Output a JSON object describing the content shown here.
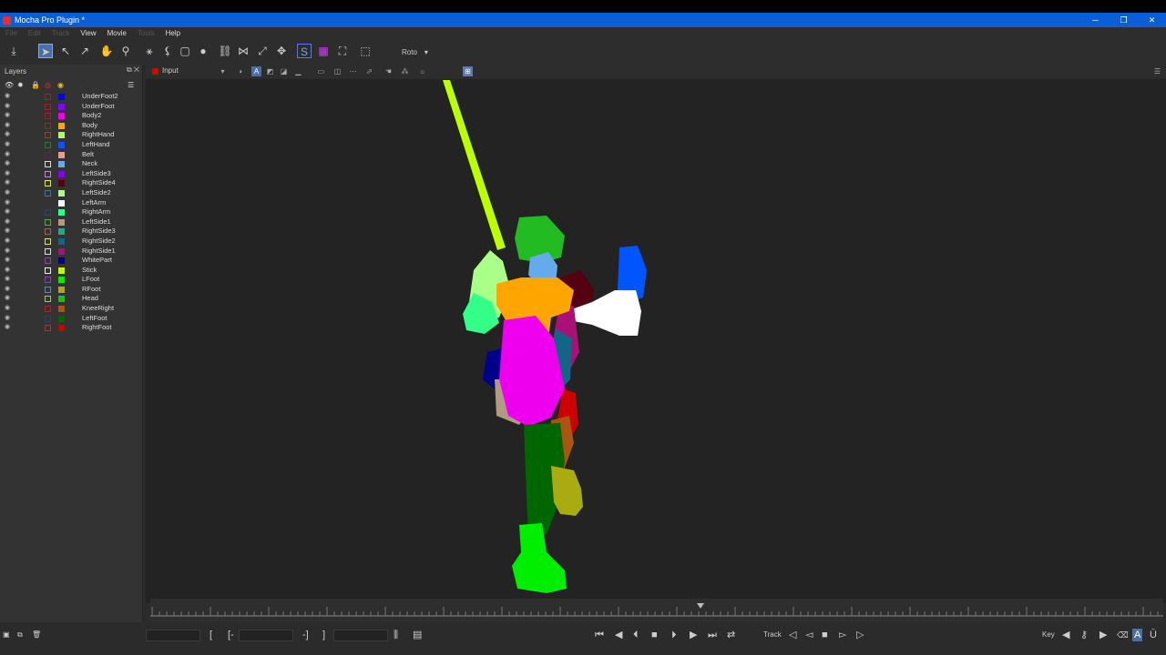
{
  "window": {
    "title": "Mocha Pro Plugin *",
    "controls": [
      "─",
      "❐",
      "✕"
    ]
  },
  "menu": [
    {
      "label": "File",
      "enabled": false
    },
    {
      "label": "Edit",
      "enabled": false
    },
    {
      "label": "Track",
      "enabled": false
    },
    {
      "label": "View",
      "enabled": true
    },
    {
      "label": "Movie",
      "enabled": true
    },
    {
      "label": "Tools",
      "enabled": false
    },
    {
      "label": "Help",
      "enabled": true
    }
  ],
  "toolbar": {
    "mode_label": "Roto",
    "mode_arrow": "▾"
  },
  "layers_panel": {
    "title": "Layers",
    "layers": [
      {
        "name": "UnderFoot2",
        "outline": "#a02020",
        "color": "#0000ff"
      },
      {
        "name": "UnderFoot",
        "outline": "#a02020",
        "color": "#8800ff"
      },
      {
        "name": "Body2",
        "outline": "#a02020",
        "color": "#ee00ee"
      },
      {
        "name": "Body",
        "outline": "#a02020",
        "color": "#ffa500"
      },
      {
        "name": "RightHand",
        "outline": "#a04020",
        "color": "#aaff66"
      },
      {
        "name": "LeftHand",
        "outline": "#208020",
        "color": "#0055ff"
      },
      {
        "name": "Belt",
        "outline": "#602060",
        "color": "#ee9a88"
      },
      {
        "name": "Neck",
        "outline": "#dddddd",
        "color": "#66aaee"
      },
      {
        "name": "LeftSide3",
        "outline": "#cc88cc",
        "color": "#8800ee"
      },
      {
        "name": "RightSide4",
        "outline": "#eeee22",
        "color": "#550011"
      },
      {
        "name": "LeftSide2",
        "outline": "#3377bb",
        "color": "#aaff88"
      },
      {
        "name": "LeftArm",
        "outline": "#333333",
        "color": "#ffffff"
      },
      {
        "name": "RightArm",
        "outline": "#224488",
        "color": "#33ff88"
      },
      {
        "name": "LeftSide1",
        "outline": "#22cc22",
        "color": "#b09a80"
      },
      {
        "name": "RightSide3",
        "outline": "#aa6622",
        "color": "#22aa88"
      },
      {
        "name": "RightSide2",
        "outline": "#dddd88",
        "color": "#116688"
      },
      {
        "name": "RightSide1",
        "outline": "#dddddd",
        "color": "#aa1177"
      },
      {
        "name": "WhitePart",
        "outline": "#8844aa",
        "color": "#000088"
      },
      {
        "name": "Stick",
        "outline": "#eeeeee",
        "color": "#bbff00"
      },
      {
        "name": "LFoot",
        "outline": "#8844aa",
        "color": "#00ee00"
      },
      {
        "name": "RFoot",
        "outline": "#22aaaa",
        "color": "#aaaa11"
      },
      {
        "name": "Head",
        "outline": "#88dd22",
        "color": "#22bb22"
      },
      {
        "name": "KneeRight",
        "outline": "#aa2222",
        "color": "#aa5511"
      },
      {
        "name": "LeftFoot",
        "outline": "#333399",
        "color": "#006600"
      },
      {
        "name": "RightFoot",
        "outline": "#cc2222",
        "color": "#cc0000"
      }
    ]
  },
  "viewer": {
    "input_label": "Input"
  },
  "bottom": {
    "track_label": "Track",
    "key_label": "Key"
  },
  "colors": {
    "accent": "#0a5fd6",
    "panel": "#333333",
    "viewer_bg": "#232323"
  }
}
